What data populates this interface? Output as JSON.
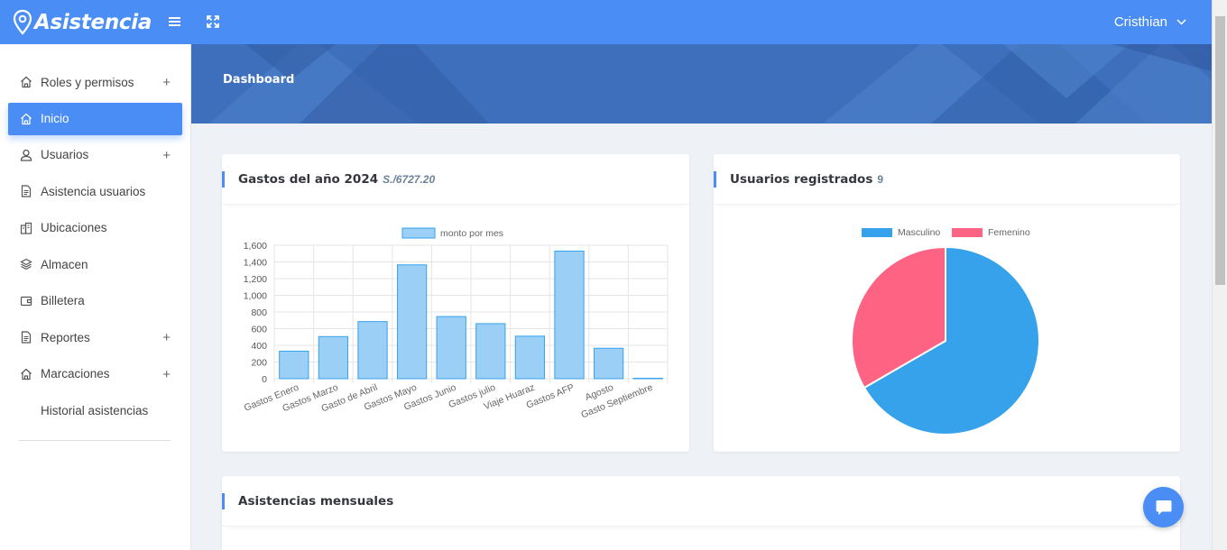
{
  "app": {
    "brand": "Asistencia",
    "user_name": "Cristhian"
  },
  "sidebar": {
    "items": [
      {
        "label": "Roles y permisos",
        "icon": "home-icon",
        "expandable": true
      },
      {
        "label": "Inicio",
        "icon": "home-icon",
        "active": true
      },
      {
        "label": "Usuarios",
        "icon": "user-icon",
        "expandable": true
      },
      {
        "label": "Asistencia usuarios",
        "icon": "document-icon"
      },
      {
        "label": "Ubicaciones",
        "icon": "buildings-icon"
      },
      {
        "label": "Almacen",
        "icon": "layers-icon"
      },
      {
        "label": "Billetera",
        "icon": "wallet-icon"
      },
      {
        "label": "Reportes",
        "icon": "document-icon",
        "expandable": true
      },
      {
        "label": "Marcaciones",
        "icon": "home-icon",
        "expandable": true
      },
      {
        "label": "Historial asistencias"
      }
    ],
    "plus_symbol": "+"
  },
  "banner": {
    "title": "Dashboard"
  },
  "cards": {
    "gastos": {
      "title": "Gastos del año 2024",
      "subtitle": "S./6727.20"
    },
    "usuarios": {
      "title": "Usuarios registrados",
      "count": "9"
    },
    "asistencias": {
      "title": "Asistencias mensuales"
    }
  },
  "colors": {
    "accent": "#4a8ef5",
    "bar_fill": "#9ccff5",
    "bar_stroke": "#36a2eb",
    "male": "#36a2eb",
    "female": "#ff6384"
  },
  "chart_data": [
    {
      "type": "bar",
      "categories": [
        "Gastos Enero",
        "Gastos Marzo",
        "Gasto de Abril",
        "Gastos Mayo",
        "Gastos Junio",
        "Gastos julio",
        "Viaje Huaraz",
        "Gastos AFP",
        "Agosto",
        "Gasto Septiembre"
      ],
      "series": [
        {
          "name": "monto por mes",
          "values": [
            330,
            505,
            685,
            1365,
            745,
            660,
            510,
            1530,
            365,
            5
          ]
        }
      ],
      "ylim": [
        0,
        1600
      ],
      "yticks": [
        "0",
        "200",
        "400",
        "600",
        "800",
        "1,000",
        "1,200",
        "1,400",
        "1,600"
      ],
      "grid": true,
      "legend": "top"
    },
    {
      "type": "pie",
      "labels": [
        "Masculino",
        "Femenino"
      ],
      "values": [
        6,
        3
      ],
      "legend": "top"
    }
  ]
}
